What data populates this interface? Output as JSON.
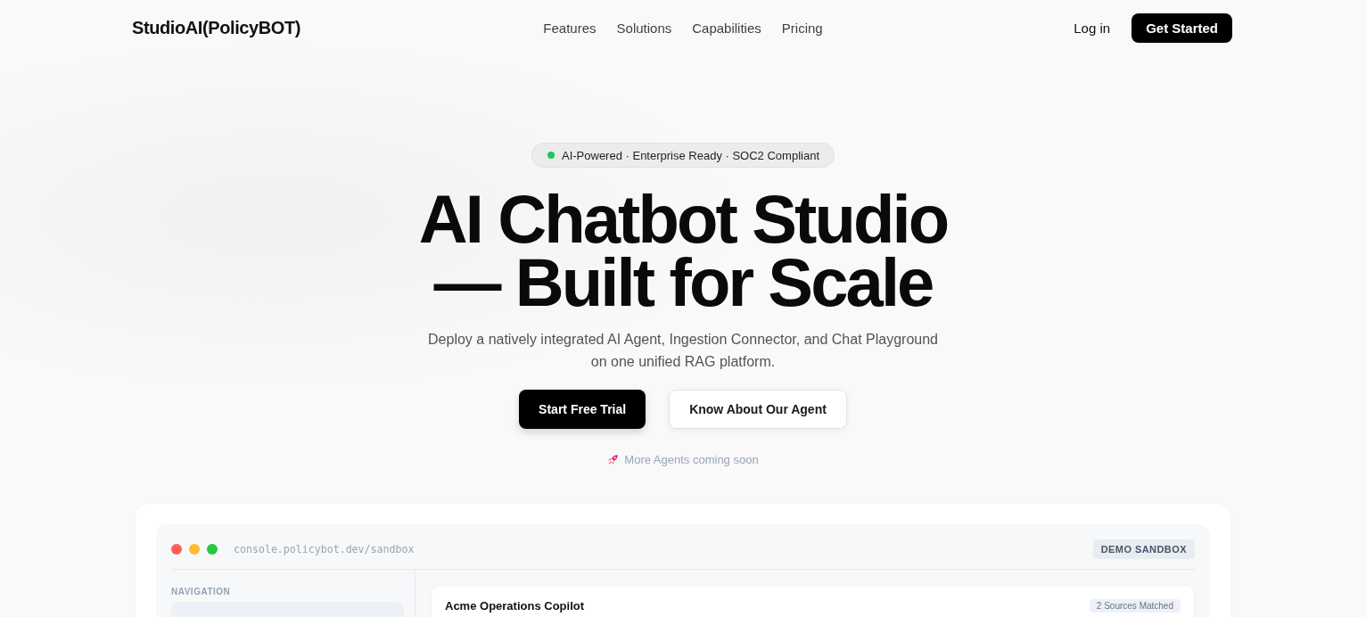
{
  "nav": {
    "logo": "StudioAI(PolicyBOT)",
    "links": [
      {
        "label": "Features"
      },
      {
        "label": "Solutions"
      },
      {
        "label": "Capabilities"
      },
      {
        "label": "Pricing"
      }
    ],
    "actions": [
      {
        "label": "Log in",
        "kind": "link"
      },
      {
        "label": "Get Started",
        "kind": "primary"
      }
    ]
  },
  "hero": {
    "badge": "AI-Powered · Enterprise Ready · SOC2 Compliant",
    "title_lines": [
      "AI Chatbot Studio",
      "— Built for Scale"
    ],
    "subtitle_lines": [
      "Deploy a natively integrated AI Agent, Ingestion Connector, and Chat Playground",
      "on one unified RAG platform."
    ],
    "buttons": [
      {
        "label": "Start Free Trial",
        "kind": "primary"
      },
      {
        "label": "Know About Our Agent",
        "kind": "secondary"
      }
    ],
    "note": "More Agents coming soon"
  },
  "preview": {
    "url": "console.policybot.dev/sandbox",
    "tag": "DEMO SANDBOX",
    "sidebar": {
      "heading": "NAVIGATION"
    },
    "panel": {
      "title": "Acme Operations Copilot",
      "badge": "2 Sources Matched"
    }
  }
}
